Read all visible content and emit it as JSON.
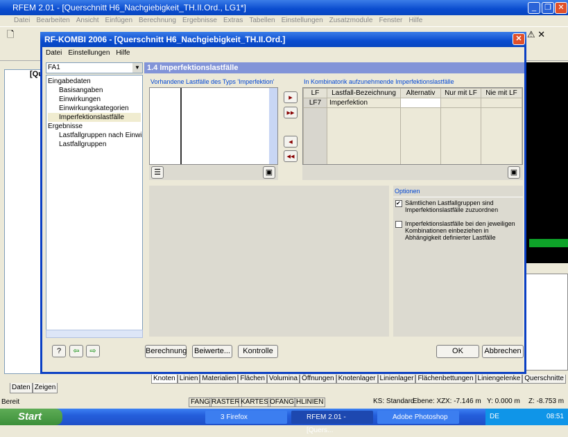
{
  "app": {
    "title": "RFEM 2.01 - [Querschnitt H6_Nachgiebigkeit_TH.II.Ord., LG1*]",
    "menu": [
      "Datei",
      "Bearbeiten",
      "Ansicht",
      "Einfügen",
      "Berechnung",
      "Ergebnisse",
      "Extras",
      "Tabellen",
      "Einstellungen",
      "Zusatzmodule",
      "Fenster",
      "Hilfe"
    ],
    "tree_root": "[Que",
    "panel_tabs": [
      "Daten",
      "Zeigen"
    ],
    "bottom_tabs": [
      "Knoten",
      "Linien",
      "Materialien",
      "Flächen",
      "Volumina",
      "Öffnungen",
      "Knotenlager",
      "Linienlager",
      "Flächenbettungen",
      "Liniengelenke",
      "Querschnitte"
    ],
    "status": {
      "ready": "Bereit",
      "toggles": [
        "FANG",
        "RASTER",
        "KARTES",
        "OFANG",
        "HLINIEN"
      ],
      "ks": "KS: Standard",
      "ebene": "Ebene: XZ",
      "x": "X: -7.146 m",
      "y": "Y: 0.000 m",
      "z": "Z: -8.753 m"
    }
  },
  "dialog": {
    "title": "RF-KOMBI 2006 - [Querschnitt H6_Nachgiebigkeit_TH.II.Ord.]",
    "menu": [
      "Datei",
      "Einstellungen",
      "Hilfe"
    ],
    "case_select": "FA1",
    "nav": [
      {
        "label": "Eingabedaten",
        "level": 0
      },
      {
        "label": "Basisangaben",
        "level": 1
      },
      {
        "label": "Einwirkungen",
        "level": 1
      },
      {
        "label": "Einwirkungskategorien",
        "level": 1
      },
      {
        "label": "Imperfektionslastfälle",
        "level": 1,
        "selected": true
      },
      {
        "label": "Ergebnisse",
        "level": 0
      },
      {
        "label": "Lastfallgruppen nach Einwirkung",
        "level": 1
      },
      {
        "label": "Lastfallgruppen",
        "level": 1
      }
    ],
    "section_title": "1.4 Imperfektionslastfälle",
    "available_label": "Vorhandene Lastfälle des Typs 'Imperfektion'",
    "selected_label": "In Kombinatorik aufzunehmende Imperfektionslastfälle",
    "columns": [
      "LF",
      "Lastfall-Bezeichnung",
      "Alternativ",
      "Nur mit LF",
      "Nie mit LF"
    ],
    "rows": [
      [
        "LF7",
        "Imperfektion",
        "",
        "",
        ""
      ]
    ],
    "options_title": "Optionen",
    "option1": "Sämtlichen Lastfallgruppen sind Imperfektionslastfälle zuzuordnen",
    "option1_checked": true,
    "option2": "Imperfektionslastfälle bei den jeweiligen Kombinationen einbeziehen in Abhängigkeit definierter Lastfälle",
    "option2_checked": false,
    "buttons": {
      "calc": "Berechnung",
      "coef": "Beiwerte...",
      "check": "Kontrolle",
      "ok": "OK",
      "cancel": "Abbrechen"
    }
  },
  "taskbar": {
    "start": "Start",
    "items": [
      "3 Firefox",
      "RFEM 2.01 - [Quers...",
      "Adobe Photoshop"
    ],
    "lang": "DE",
    "time": "08:51"
  }
}
